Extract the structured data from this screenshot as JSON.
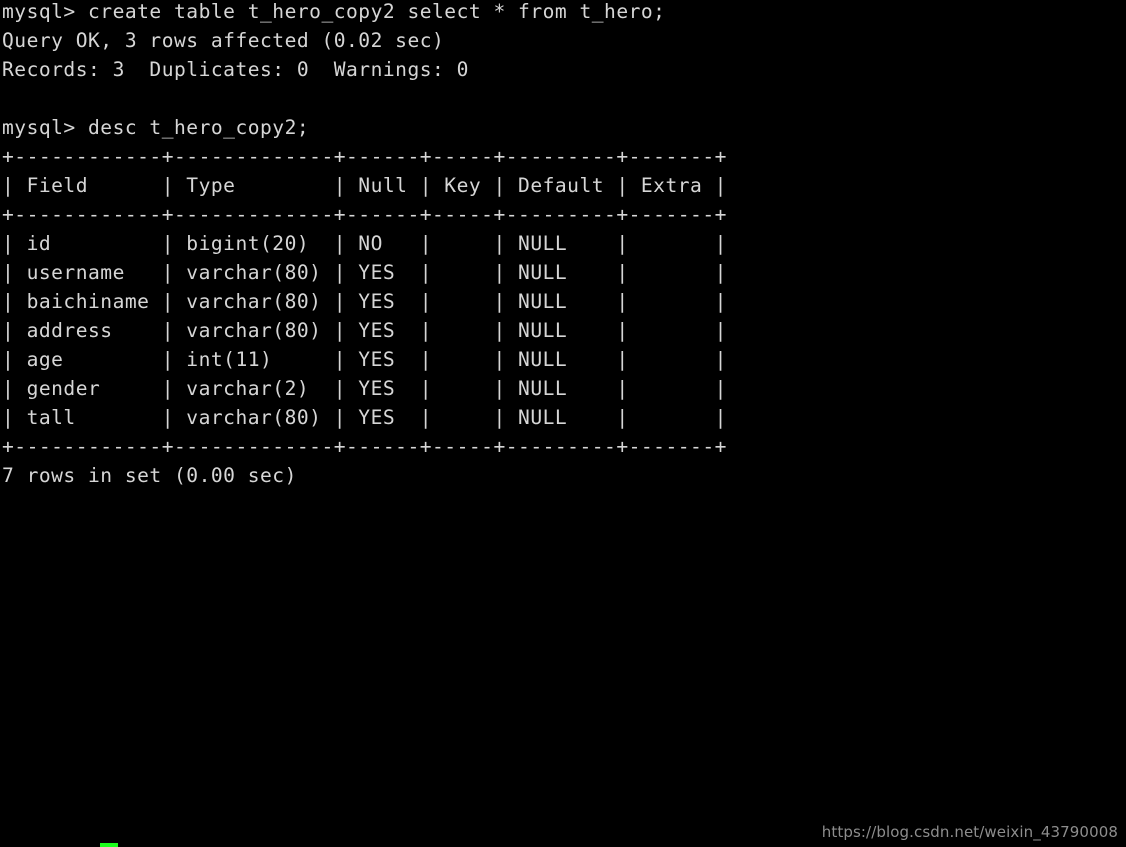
{
  "terminal": {
    "title": "mysql-client-terminal",
    "columns": 56,
    "background_color": "#000000",
    "foreground_color": "#d6d6d6",
    "cursor_color": "#1cff1c",
    "prompt": "mysql> ",
    "commands": [
      "create table t_hero_copy2 select * from t_hero;",
      "desc t_hero_copy2;"
    ],
    "output_text": "mysql> create table t_hero_copy2 select * from t_hero;\nQuery OK, 3 rows affected (0.02 sec)\nRecords: 3  Duplicates: 0  Warnings: 0\n\nmysql> desc t_hero_copy2;\n+------------+-------------+------+-----+---------+-------+\n| Field      | Type        | Null | Key | Default | Extra |\n+------------+-------------+------+-----+---------+-------+\n| id         | bigint(20)  | NO   |     | NULL    |       |\n| username   | varchar(80) | YES  |     | NULL    |       |\n| baichiname | varchar(80) | YES  |     | NULL    |       |\n| address    | varchar(80) | YES  |     | NULL    |       |\n| age        | int(11)     | YES  |     | NULL    |       |\n| gender     | varchar(2)  | YES  |     | NULL    |       |\n| tall       | varchar(80) | YES  |     | NULL    |       |\n+------------+-------------+------+-----+---------+-------+\n7 rows in set (0.00 sec)\n",
    "messages": {
      "query_ok": "Query OK, 3 rows affected (0.02 sec)",
      "records": "Records: 3  Duplicates: 0  Warnings: 0",
      "rows_in_set": "7 rows in set (0.00 sec)"
    },
    "describe_table": {
      "table_name": "t_hero_copy2",
      "separator": "+------------+-------------+------+-----+---------+-------+",
      "columns": [
        "Field",
        "Type",
        "Null",
        "Key",
        "Default",
        "Extra"
      ],
      "rows": [
        {
          "Field": "id",
          "Type": "bigint(20)",
          "Null": "NO",
          "Key": "",
          "Default": "NULL",
          "Extra": ""
        },
        {
          "Field": "username",
          "Type": "varchar(80)",
          "Null": "YES",
          "Key": "",
          "Default": "NULL",
          "Extra": ""
        },
        {
          "Field": "baichiname",
          "Type": "varchar(80)",
          "Null": "YES",
          "Key": "",
          "Default": "NULL",
          "Extra": ""
        },
        {
          "Field": "address",
          "Type": "varchar(80)",
          "Null": "YES",
          "Key": "",
          "Default": "NULL",
          "Extra": ""
        },
        {
          "Field": "age",
          "Type": "int(11)",
          "Null": "YES",
          "Key": "",
          "Default": "NULL",
          "Extra": ""
        },
        {
          "Field": "gender",
          "Type": "varchar(2)",
          "Null": "YES",
          "Key": "",
          "Default": "NULL",
          "Extra": ""
        },
        {
          "Field": "tall",
          "Type": "varchar(80)",
          "Null": "YES",
          "Key": "",
          "Default": "NULL",
          "Extra": ""
        }
      ]
    }
  },
  "watermark": {
    "text": "https://blog.csdn.net/weixin_43790008"
  }
}
